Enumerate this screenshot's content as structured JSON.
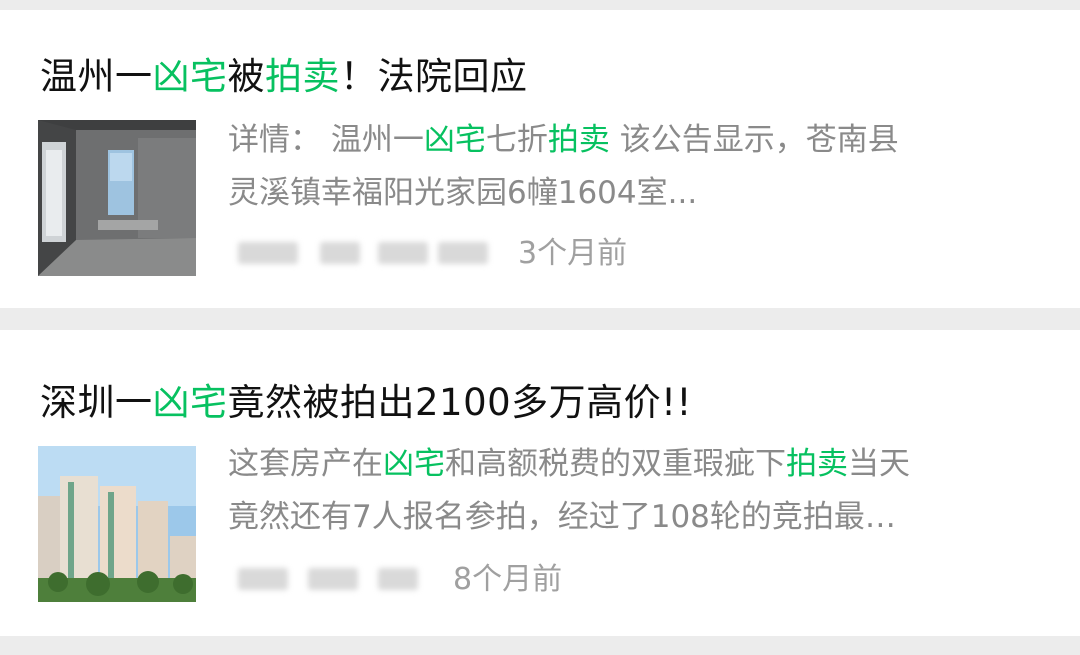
{
  "results": [
    {
      "title_parts": [
        {
          "text": "温州一",
          "hl": false
        },
        {
          "text": "凶宅",
          "hl": true
        },
        {
          "text": "被",
          "hl": false
        },
        {
          "text": "拍卖",
          "hl": true
        },
        {
          "text": "！法院回应",
          "hl": false
        }
      ],
      "summary_parts": [
        {
          "text": "详情： 温州一",
          "hl": false
        },
        {
          "text": "凶宅",
          "hl": true
        },
        {
          "text": "七折",
          "hl": false
        },
        {
          "text": "拍卖",
          "hl": true
        },
        {
          "text": " 该公告显示，苍南县",
          "hl": false
        },
        {
          "text": "\n灵溪镇幸福阳光家园6幢1604室...",
          "hl": false
        }
      ],
      "time": "3个月前"
    },
    {
      "title_parts": [
        {
          "text": "深圳一",
          "hl": false
        },
        {
          "text": "凶宅",
          "hl": true
        },
        {
          "text": "竟然被拍出2100多万高价!!",
          "hl": false
        }
      ],
      "summary_parts": [
        {
          "text": "这套房产在",
          "hl": false
        },
        {
          "text": "凶宅",
          "hl": true
        },
        {
          "text": "和高额税费的双重瑕疵下",
          "hl": false
        },
        {
          "text": "拍卖",
          "hl": true
        },
        {
          "text": "当天",
          "hl": false
        },
        {
          "text": "\n竟然还有7人报名参拍，经过了108轮的竞拍最…",
          "hl": false
        }
      ],
      "time": "8个月前"
    }
  ],
  "colors": {
    "highlight": "#07c160",
    "title": "#111111",
    "summary": "#8a8a8a",
    "meta": "#a0a0a0"
  },
  "thumbnails": [
    "unfinished-room-photo",
    "high-rise-apartment-photo"
  ]
}
